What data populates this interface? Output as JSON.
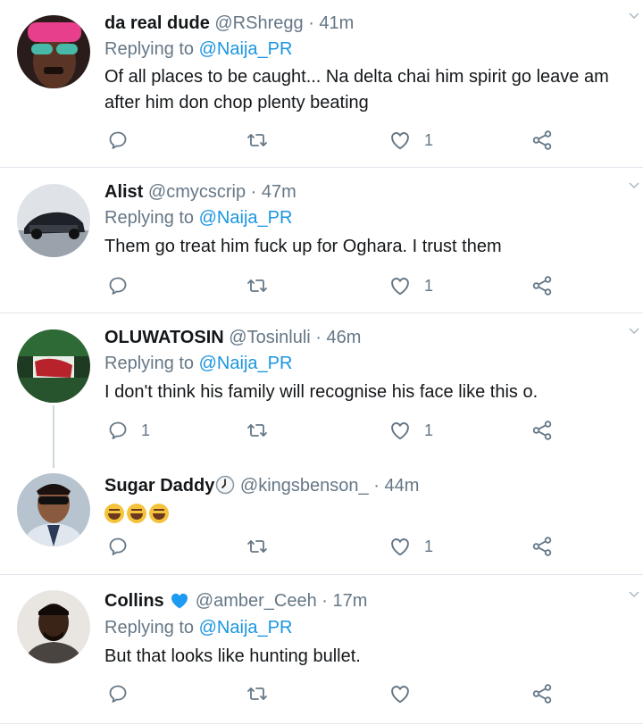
{
  "replying_prefix": "Replying to",
  "tweets": [
    {
      "name": "da real dude",
      "handle": "@RShregg",
      "separator": "·",
      "time": "41m",
      "replying_to": "@Naija_PR",
      "text": "Of all places to be caught... Na delta chai him spirit go leave am after him don chop plenty beating",
      "reply_count": "",
      "retweet_count": "",
      "like_count": "1"
    },
    {
      "name": "Alist",
      "handle": "@cmycscrip",
      "separator": "·",
      "time": "47m",
      "replying_to": "@Naija_PR",
      "text": "Them go treat him fuck up for Oghara. I trust them",
      "reply_count": "",
      "retweet_count": "",
      "like_count": "1"
    },
    {
      "name": "OLUWATOSIN",
      "handle": "@Tosinluli",
      "separator": "·",
      "time": "46m",
      "replying_to": "@Naija_PR",
      "text": "I don't think his family will recognise his face like this o.",
      "reply_count": "1",
      "retweet_count": "",
      "like_count": "1"
    },
    {
      "name": "Sugar Daddy",
      "name_icon": "clock-icon",
      "handle": "@kingsbenson_",
      "separator": "·",
      "time": "44m",
      "text_icons": [
        "laughing-emoji",
        "laughing-emoji",
        "laughing-emoji"
      ],
      "reply_count": "",
      "retweet_count": "",
      "like_count": "1"
    },
    {
      "name": "Collins",
      "name_icon": "blue-heart-icon",
      "handle": "@amber_Ceeh",
      "separator": "·",
      "time": "17m",
      "replying_to": "@Naija_PR",
      "text": "But that looks like hunting bullet.",
      "reply_count": "",
      "retweet_count": "",
      "like_count": ""
    }
  ],
  "colors": {
    "link": "#1b95e0",
    "secondary_text": "#657786",
    "primary_text": "#14171a",
    "divider": "#e1e8ed",
    "heart_emoji": "#1d9bf0"
  }
}
